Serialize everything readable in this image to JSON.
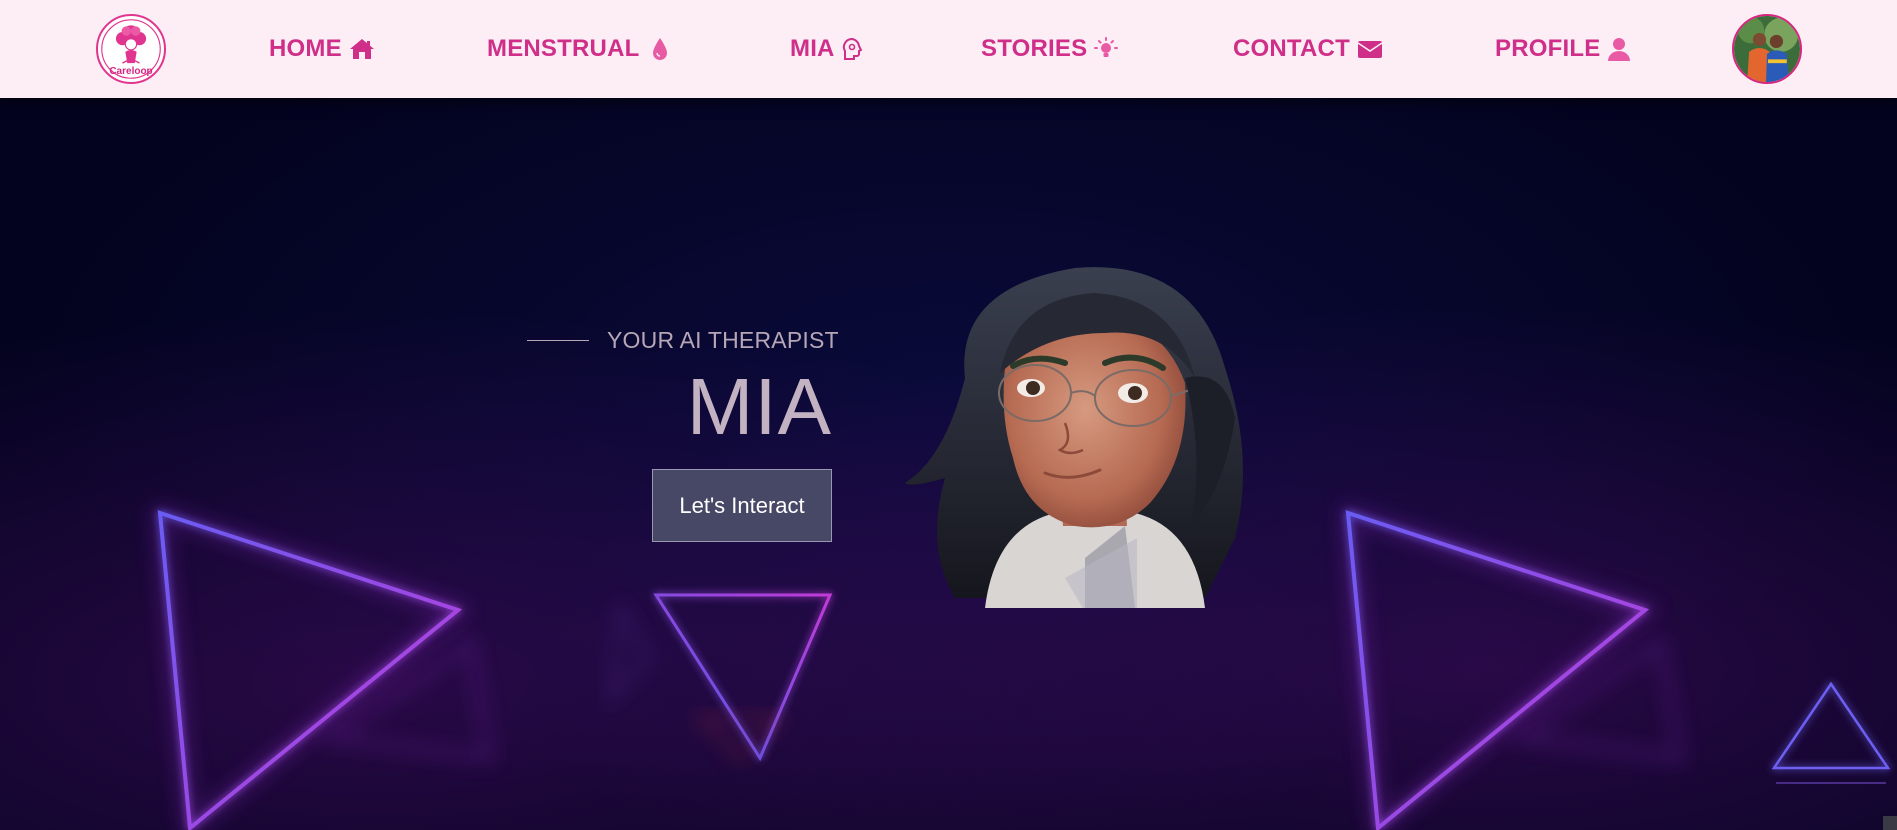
{
  "brand": {
    "logo_text": "Careloop"
  },
  "nav": {
    "items": [
      {
        "label": "HOME",
        "icon": "home-icon"
      },
      {
        "label": "MENSTRUAL",
        "icon": "droplet-icon"
      },
      {
        "label": "MIA",
        "icon": "brain-head-icon"
      },
      {
        "label": "STORIES",
        "icon": "lightbulb-icon"
      },
      {
        "label": "CONTACT",
        "icon": "envelope-icon"
      },
      {
        "label": "PROFILE",
        "icon": "user-icon"
      }
    ]
  },
  "hero": {
    "subtitle": "YOUR AI THERAPIST",
    "title": "MIA",
    "cta_label": "Let's Interact"
  },
  "colors": {
    "nav_background": "#fdeef6",
    "nav_text": "#cf2f88",
    "hero_background": "#05052a",
    "cta_background": "#474766",
    "neon_purple": "#b43de0",
    "neon_blue": "#5a5cf0"
  }
}
